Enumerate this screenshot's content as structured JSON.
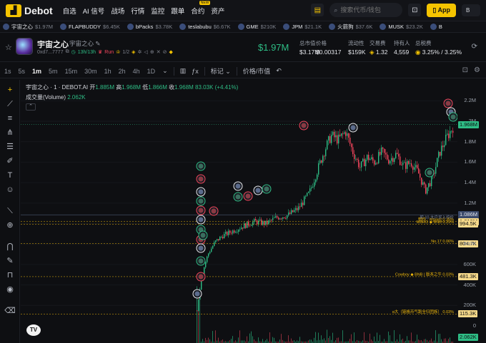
{
  "nav": {
    "logo_text": "Debot",
    "items": [
      "自选",
      "AI 信号",
      "战场",
      "行情",
      "监控",
      "跟单",
      "合约",
      "资产"
    ],
    "contract_badge": "NEW",
    "search_placeholder": "搜索代币/钱包",
    "app_label": "App",
    "account_label": "B"
  },
  "ticker": [
    {
      "name": "宇宙之心",
      "value": "$1.97M"
    },
    {
      "name": "FLAPBUDDY",
      "value": "$6.45K"
    },
    {
      "name": "bPacks",
      "value": "$3.78K"
    },
    {
      "name": "teslabubu",
      "value": "$6.67K"
    },
    {
      "name": "GME",
      "value": "$210K"
    },
    {
      "name": "JPM",
      "value": "$21.1K"
    },
    {
      "name": "火箭狗",
      "value": "$37.6K"
    },
    {
      "name": "MUSK",
      "value": "$23.2K"
    },
    {
      "name": "B",
      "value": ""
    }
  ],
  "token": {
    "name": "宇宙之心",
    "sub_name": "宇宙之心",
    "address": "0xd7...7777",
    "age": "13h/13h",
    "run_label": "Run",
    "ratio": "1/2",
    "price": "$1.97M",
    "stats": [
      {
        "label": "总市值",
        "value": "$3.17M"
      },
      {
        "label": "价格",
        "value": "$0.00317"
      },
      {
        "label": "流动性",
        "value": "$159K"
      },
      {
        "label": "交易费",
        "value": "1.32"
      },
      {
        "label": "持有人",
        "value": "4,559"
      },
      {
        "label": "总税费",
        "value": "3.25% / 3.25%"
      }
    ]
  },
  "toolbar": {
    "timeframes": [
      "1s",
      "5s",
      "1m",
      "5m",
      "15m",
      "30m",
      "1h",
      "2h",
      "4h",
      "1D"
    ],
    "active_timeframe": "1m",
    "marker_label": "标记",
    "price_label": "价格/市值"
  },
  "chart_data": {
    "type": "candlestick",
    "title": "宇宙之心 · 1 · DEBOT.AI",
    "ohlc": {
      "open_label": "开",
      "open": "1.885M",
      "high_label": "高",
      "high": "1.968M",
      "low_label": "低",
      "low": "1.866M",
      "close_label": "收",
      "close": "1.968M",
      "volume": "83.03K",
      "change": "(+4.41%)"
    },
    "volume_label": "成交量(Volume)",
    "volume_value": "2.062K",
    "y_ticks": [
      "2.2M",
      "2M",
      "1.8M",
      "1.6M",
      "1.4M",
      "1.2M",
      "800K",
      "600K",
      "400K",
      "200K",
      "0"
    ],
    "ylim": [
      0,
      2300000
    ],
    "current_price_label": "1.968M",
    "current_price": 1968000,
    "current_volume_label": "2.062K",
    "price_series": [
      {
        "x": 0,
        "close": 150000
      },
      {
        "x": 2,
        "close": 420000
      },
      {
        "x": 4,
        "close": 580000
      },
      {
        "x": 6,
        "close": 700000
      },
      {
        "x": 10,
        "close": 820000
      },
      {
        "x": 14,
        "close": 880000
      },
      {
        "x": 20,
        "close": 930000
      },
      {
        "x": 26,
        "close": 980000
      },
      {
        "x": 32,
        "close": 1020000
      },
      {
        "x": 38,
        "close": 1000000
      },
      {
        "x": 44,
        "close": 1060000
      },
      {
        "x": 50,
        "close": 1080000
      },
      {
        "x": 56,
        "close": 1150000
      },
      {
        "x": 62,
        "close": 1300000
      },
      {
        "x": 66,
        "close": 1500000
      },
      {
        "x": 70,
        "close": 1700000
      },
      {
        "x": 74,
        "close": 1860000
      },
      {
        "x": 78,
        "close": 1820000
      },
      {
        "x": 82,
        "close": 1900000
      },
      {
        "x": 86,
        "close": 1700000
      },
      {
        "x": 90,
        "close": 1550000
      },
      {
        "x": 94,
        "close": 1650000
      },
      {
        "x": 98,
        "close": 1600000
      },
      {
        "x": 102,
        "close": 1700000
      },
      {
        "x": 106,
        "close": 1620000
      },
      {
        "x": 110,
        "close": 1680000
      },
      {
        "x": 114,
        "close": 1560000
      },
      {
        "x": 118,
        "close": 1600000
      },
      {
        "x": 122,
        "close": 1500000
      },
      {
        "x": 126,
        "close": 1320000
      },
      {
        "x": 130,
        "close": 1450000
      },
      {
        "x": 134,
        "close": 1700000
      },
      {
        "x": 138,
        "close": 1850000
      },
      {
        "x": 142,
        "close": 1968000
      }
    ],
    "price_lines": [
      {
        "label": "",
        "value_label": "1.086M",
        "value": 1086000,
        "color": "#5b6b8c"
      },
      {
        "label": "前 10 大户买入均价",
        "value_label": "",
        "value": 1086000,
        "color": "#5b6b8c"
      },
      {
        "label": "制作 · Market 0.35%",
        "value_label": "1.019M",
        "value": 1019000,
        "color": "#f0b90b"
      },
      {
        "label": "MBRO ◆ BNB 0.29%",
        "value_label": "994.5K",
        "value": 994500,
        "color": "#f0b90b"
      },
      {
        "label": "No.17 0.06%",
        "value_label": "804.7K",
        "value": 804700,
        "color": "#f0b90b"
      },
      {
        "label": "Cowboy ◆ BNB | 版本之牛 0.03%",
        "value_label": "481.3K",
        "value": 481300,
        "color": "#f0b90b"
      },
      {
        "label": "α大（链格币气跑全归团族） 0.03%",
        "value_label": "115.3K",
        "value": 115300,
        "color": "#f0b90b"
      }
    ]
  }
}
